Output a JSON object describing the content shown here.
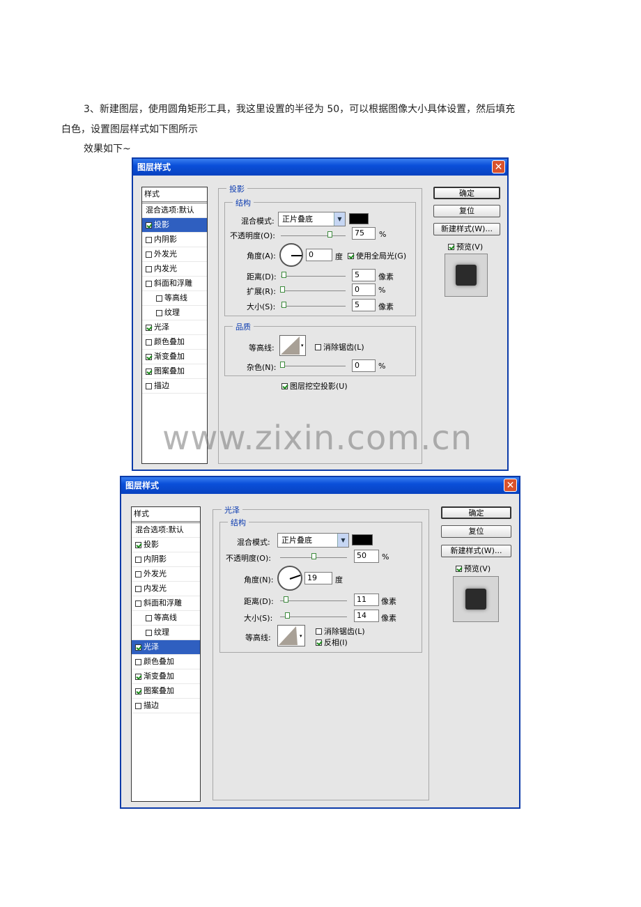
{
  "paragraph": {
    "line1": "3、新建图层，使用圆角矩形工具，我这里设置的半径为 50，可以根据图像大小具体设置，然后填充",
    "line2": "白色，设置图层样式如下图所示",
    "effect": "效果如下~"
  },
  "watermark": "www.zixin.com.cn",
  "dialog1": {
    "title": "图层样式",
    "close": "✕",
    "styles_header": "样式",
    "style_items": [
      {
        "label": "混合选项:默认",
        "checked": null
      },
      {
        "label": "投影",
        "checked": true,
        "selected": true
      },
      {
        "label": "内阴影",
        "checked": false
      },
      {
        "label": "外发光",
        "checked": false
      },
      {
        "label": "内发光",
        "checked": false
      },
      {
        "label": "斜面和浮雕",
        "checked": false
      },
      {
        "label": "等高线",
        "checked": false,
        "sub": true
      },
      {
        "label": "纹理",
        "checked": false,
        "sub": true
      },
      {
        "label": "光泽",
        "checked": true
      },
      {
        "label": "颜色叠加",
        "checked": false
      },
      {
        "label": "渐变叠加",
        "checked": true
      },
      {
        "label": "图案叠加",
        "checked": true
      },
      {
        "label": "描边",
        "checked": false
      }
    ],
    "section_title": "投影",
    "structure": "结构",
    "blend_mode_label": "混合模式:",
    "blend_mode": "正片叠底",
    "opacity_label": "不透明度(O):",
    "opacity": "75",
    "opacity_level": 0.75,
    "percent": "%",
    "angle_label": "角度(A):",
    "angle": "0",
    "angle_deg": 0,
    "degree_unit": "度",
    "global_light": "使用全局光(G)",
    "global_light_checked": true,
    "distance_label": "距离(D):",
    "distance": "5",
    "spread_label": "扩展(R):",
    "spread": "0",
    "size_label": "大小(S):",
    "size": "5",
    "pixel_unit": "像素",
    "quality": "品质",
    "contour_label": "等高线:",
    "antialias": "消除锯齿(L)",
    "noise_label": "杂色(N):",
    "noise": "0",
    "knockout": "图层挖空投影(U)",
    "ok": "确定",
    "reset": "复位",
    "new_style": "新建样式(W)...",
    "preview": "预览(V)"
  },
  "dialog2": {
    "title": "图层样式",
    "close": "✕",
    "styles_header": "样式",
    "style_items": [
      {
        "label": "混合选项:默认",
        "checked": null
      },
      {
        "label": "投影",
        "checked": true
      },
      {
        "label": "内阴影",
        "checked": false
      },
      {
        "label": "外发光",
        "checked": false
      },
      {
        "label": "内发光",
        "checked": false
      },
      {
        "label": "斜面和浮雕",
        "checked": false
      },
      {
        "label": "等高线",
        "checked": false,
        "sub": true
      },
      {
        "label": "纹理",
        "checked": false,
        "sub": true
      },
      {
        "label": "光泽",
        "checked": true,
        "selected": true
      },
      {
        "label": "颜色叠加",
        "checked": false
      },
      {
        "label": "渐变叠加",
        "checked": true
      },
      {
        "label": "图案叠加",
        "checked": true
      },
      {
        "label": "描边",
        "checked": false
      }
    ],
    "section_title": "光泽",
    "structure": "结构",
    "blend_mode_label": "混合模式:",
    "blend_mode": "正片叠底",
    "opacity_label": "不透明度(O):",
    "opacity": "50",
    "percent": "%",
    "angle_label": "角度(N):",
    "angle": "19",
    "angle_deg": 19,
    "degree_unit": "度",
    "distance_label": "距离(D):",
    "distance": "11",
    "size_label": "大小(S):",
    "size": "14",
    "pixel_unit": "像素",
    "contour_label": "等高线:",
    "antialias": "消除锯齿(L)",
    "invert": "反相(I)",
    "invert_checked": true,
    "ok": "确定",
    "reset": "复位",
    "new_style": "新建样式(W)...",
    "preview": "预览(V)"
  }
}
